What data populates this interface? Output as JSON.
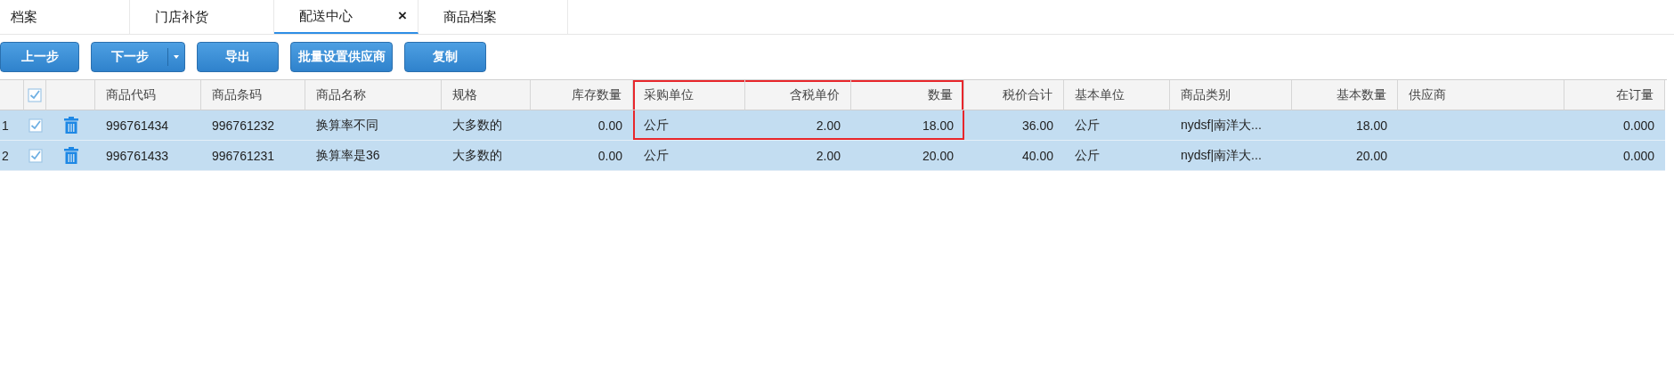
{
  "tabs": [
    {
      "label": "档案",
      "selected": false
    },
    {
      "label": "门店补货",
      "selected": false
    },
    {
      "label": "配送中心",
      "selected": true,
      "close": "×"
    },
    {
      "label": "商品档案",
      "selected": false
    }
  ],
  "toolbar": [
    {
      "label": "上一步",
      "kind": "plain"
    },
    {
      "label": "下一步",
      "kind": "split"
    },
    {
      "label": "导出",
      "kind": "plain"
    },
    {
      "label": "批量设置供应商",
      "kind": "plain"
    },
    {
      "label": "复制",
      "kind": "plain"
    }
  ],
  "table": {
    "header_checked": true,
    "columns": [
      {
        "label": "商品代码",
        "kind": "text",
        "highlighted": false
      },
      {
        "label": "商品条码",
        "kind": "text",
        "highlighted": false
      },
      {
        "label": "商品名称",
        "kind": "text",
        "highlighted": false
      },
      {
        "label": "规格",
        "kind": "text",
        "highlighted": false
      },
      {
        "label": "库存数量",
        "kind": "number",
        "highlighted": false
      },
      {
        "label": "采购单位",
        "kind": "text",
        "highlighted": true
      },
      {
        "label": "含税单价",
        "kind": "number",
        "highlighted": true
      },
      {
        "label": "数量",
        "kind": "number",
        "highlighted": true
      },
      {
        "label": "税价合计",
        "kind": "number",
        "highlighted": false
      },
      {
        "label": "基本单位",
        "kind": "text",
        "highlighted": false
      },
      {
        "label": "商品类别",
        "kind": "text",
        "highlighted": false
      },
      {
        "label": "基本数量",
        "kind": "number",
        "highlighted": false
      },
      {
        "label": "供应商",
        "kind": "text",
        "highlighted": false
      },
      {
        "label": "在订量",
        "kind": "number",
        "highlighted": false
      }
    ],
    "rows": [
      {
        "index": "1",
        "selected": true,
        "checked": true,
        "highlighted": true,
        "cells": [
          "996761434",
          "996761232",
          "换算率不同",
          "大多数的",
          "0.00",
          "公斤",
          "2.00",
          "18.00",
          "36.00",
          "公斤",
          "nydsf|南洋大...",
          "18.00",
          null,
          "0.000"
        ]
      },
      {
        "index": "2",
        "selected": true,
        "checked": true,
        "highlighted": false,
        "cells": [
          "996761433",
          "996761231",
          "换算率是36",
          "大多数的",
          "0.00",
          "公斤",
          "2.00",
          "20.00",
          "40.00",
          "公斤",
          "nydsf|南洋大...",
          "20.00",
          null,
          "0.000"
        ]
      }
    ]
  }
}
